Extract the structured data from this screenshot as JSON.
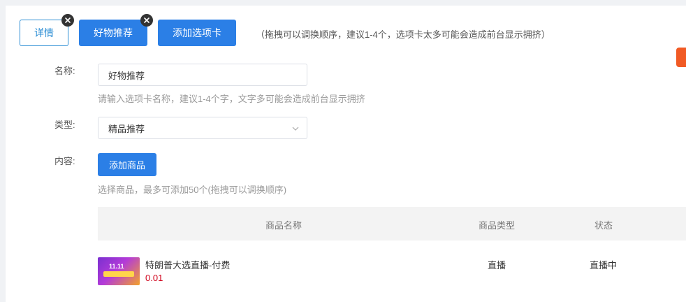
{
  "tabs": [
    {
      "label": "详情"
    },
    {
      "label": "好物推荐"
    },
    {
      "label": "添加选项卡"
    }
  ],
  "tab_hint": "（拖拽可以调换顺序，建议1-4个，选项卡太多可能会造成前台显示拥挤）",
  "form": {
    "name": {
      "label": "名称:",
      "value": "好物推荐",
      "hint": "请输入选项卡名称，建议1-4个字，文字多可能会造成前台显示拥挤"
    },
    "type": {
      "label": "类型:",
      "value": "精品推荐"
    },
    "content": {
      "label": "内容:",
      "add_button": "添加商品",
      "hint": "选择商品，最多可添加50个(拖拽可以调换顺序)"
    }
  },
  "table": {
    "headers": [
      "商品名称",
      "商品类型",
      "状态"
    ],
    "rows": [
      {
        "name": "特朗普大选直播-付费",
        "price": "0.01",
        "type": "直播",
        "status": "直播中",
        "thumb_text": "11.11"
      }
    ]
  },
  "colors": {
    "primary": "#2b7fe6",
    "price": "#d0021b",
    "badge": "#f15a24"
  }
}
